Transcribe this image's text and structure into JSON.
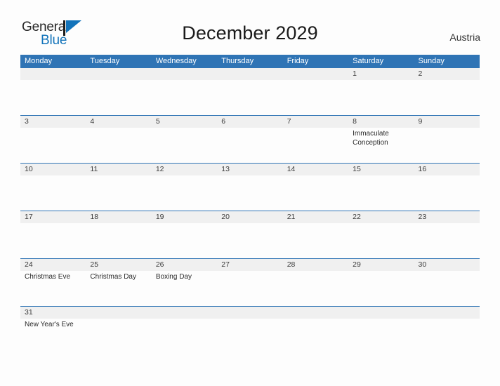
{
  "brand": {
    "name_part1": "General",
    "name_part2": "Blue",
    "flag_icon": "flag-triangle-icon",
    "color_dark": "#262626",
    "color_blue": "#1273ba"
  },
  "header": {
    "title": "December 2029",
    "region": "Austria"
  },
  "theme": {
    "header_row_blue": "#2f74b5",
    "daynum_strip_gray": "#f0f0f0",
    "page_background": "#fdfdfd",
    "row_divider_blue": "#2f74b5"
  },
  "calendar": {
    "weekdays": [
      "Monday",
      "Tuesday",
      "Wednesday",
      "Thursday",
      "Friday",
      "Saturday",
      "Sunday"
    ],
    "weeks": [
      {
        "days": [
          {
            "number": "",
            "events": []
          },
          {
            "number": "",
            "events": []
          },
          {
            "number": "",
            "events": []
          },
          {
            "number": "",
            "events": []
          },
          {
            "number": "",
            "events": []
          },
          {
            "number": "1",
            "events": []
          },
          {
            "number": "2",
            "events": []
          }
        ]
      },
      {
        "days": [
          {
            "number": "3",
            "events": []
          },
          {
            "number": "4",
            "events": []
          },
          {
            "number": "5",
            "events": []
          },
          {
            "number": "6",
            "events": []
          },
          {
            "number": "7",
            "events": []
          },
          {
            "number": "8",
            "events": [
              "Immaculate Conception"
            ]
          },
          {
            "number": "9",
            "events": []
          }
        ]
      },
      {
        "days": [
          {
            "number": "10",
            "events": []
          },
          {
            "number": "11",
            "events": []
          },
          {
            "number": "12",
            "events": []
          },
          {
            "number": "13",
            "events": []
          },
          {
            "number": "14",
            "events": []
          },
          {
            "number": "15",
            "events": []
          },
          {
            "number": "16",
            "events": []
          }
        ]
      },
      {
        "days": [
          {
            "number": "17",
            "events": []
          },
          {
            "number": "18",
            "events": []
          },
          {
            "number": "19",
            "events": []
          },
          {
            "number": "20",
            "events": []
          },
          {
            "number": "21",
            "events": []
          },
          {
            "number": "22",
            "events": []
          },
          {
            "number": "23",
            "events": []
          }
        ]
      },
      {
        "days": [
          {
            "number": "24",
            "events": [
              "Christmas Eve"
            ]
          },
          {
            "number": "25",
            "events": [
              "Christmas Day"
            ]
          },
          {
            "number": "26",
            "events": [
              "Boxing Day"
            ]
          },
          {
            "number": "27",
            "events": []
          },
          {
            "number": "28",
            "events": []
          },
          {
            "number": "29",
            "events": []
          },
          {
            "number": "30",
            "events": []
          }
        ]
      },
      {
        "days": [
          {
            "number": "31",
            "events": [
              "New Year's Eve"
            ]
          },
          {
            "number": "",
            "events": []
          },
          {
            "number": "",
            "events": []
          },
          {
            "number": "",
            "events": []
          },
          {
            "number": "",
            "events": []
          },
          {
            "number": "",
            "events": []
          },
          {
            "number": "",
            "events": []
          }
        ]
      }
    ]
  }
}
